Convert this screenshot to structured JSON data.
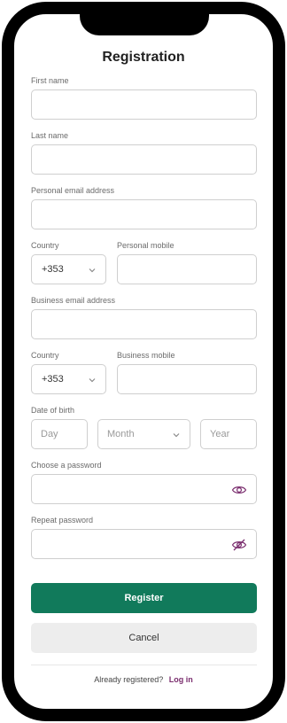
{
  "title": "Registration",
  "labels": {
    "first_name": "First name",
    "last_name": "Last name",
    "personal_email": "Personal email address",
    "country1": "Country",
    "personal_mobile": "Personal mobile",
    "business_email": "Business email address",
    "country2": "Country",
    "business_mobile": "Business mobile",
    "dob": "Date of birth",
    "password": "Choose a password",
    "repeat_password": "Repeat password"
  },
  "values": {
    "first_name": "",
    "last_name": "",
    "personal_email": "",
    "country1": "+353",
    "personal_mobile": "",
    "business_email": "",
    "country2": "+353",
    "business_mobile": "",
    "password": "",
    "repeat_password": ""
  },
  "dob": {
    "day_placeholder": "Day",
    "month_placeholder": "Month",
    "year_placeholder": "Year"
  },
  "buttons": {
    "register": "Register",
    "cancel": "Cancel"
  },
  "footer": {
    "text": "Already registered?",
    "link": "Log in"
  },
  "colors": {
    "primary": "#117a5b",
    "accent": "#7a2d6e",
    "cancel_bg": "#ededed"
  },
  "icons": {
    "show_password": "eye-icon",
    "hide_password": "eye-slash-icon",
    "dropdown": "chevron-down-icon"
  }
}
